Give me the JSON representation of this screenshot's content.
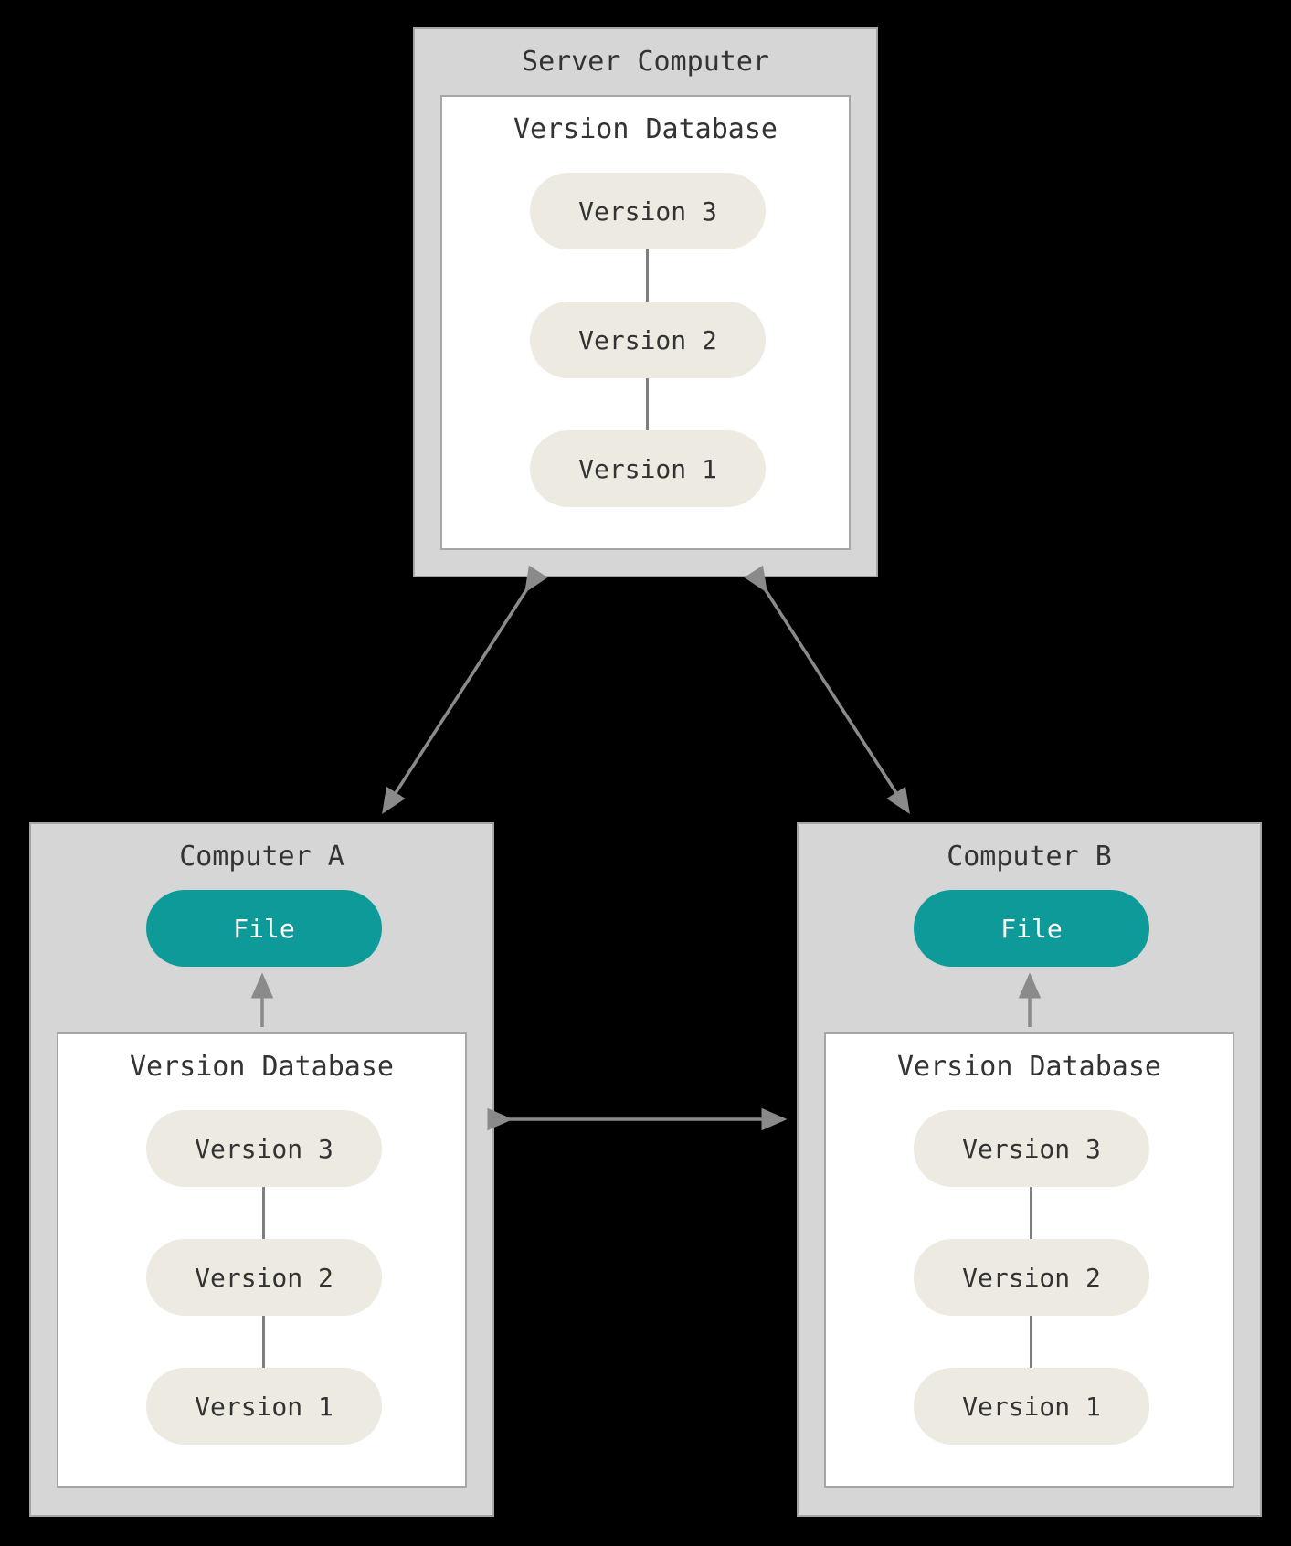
{
  "server": {
    "title": "Server Computer",
    "database": {
      "title": "Version Database",
      "versions": [
        "Version 3",
        "Version 2",
        "Version 1"
      ]
    }
  },
  "clientA": {
    "title": "Computer A",
    "file_label": "File",
    "database": {
      "title": "Version Database",
      "versions": [
        "Version 3",
        "Version 2",
        "Version 1"
      ]
    }
  },
  "clientB": {
    "title": "Computer B",
    "file_label": "File",
    "database": {
      "title": "Version Database",
      "versions": [
        "Version 3",
        "Version 2",
        "Version 1"
      ]
    }
  },
  "colors": {
    "node_bg": "#d6d6d6",
    "node_border": "#a6a6a6",
    "pill_bg": "#edeae2",
    "file_bg": "#0f9a9a",
    "arrow": "#8a8a8a"
  }
}
